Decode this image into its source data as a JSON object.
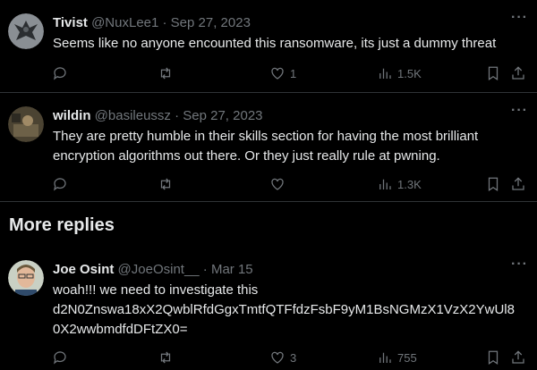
{
  "tweets": [
    {
      "name": "Tivist",
      "meta": "@NuxLee1 · Sep 27, 2023",
      "text": "Seems like no anyone encounted this ransomware, its just a dummy threat",
      "likes": "1",
      "views": "1.5K"
    },
    {
      "name": "wildin",
      "meta": "@basileussz · Sep 27, 2023",
      "text": "They are pretty humble in their skills section for having the most brilliant encryption algorithms out there. Or they just really rule at pwning.",
      "likes": "",
      "views": "1.3K"
    },
    {
      "name": "Joe Osint",
      "meta": "@JoeOsint__ · Mar 15",
      "text_line1": "woah!!! we need to investigate this",
      "text_line2": "d2N0Znswa18xX2QwblRfdGgxTmtfQTFfdzFsbF9yM1BsNGMzX1VzX2YwUl8",
      "text_line3": "0X2wwbmdfdDFtZX0=",
      "likes": "3",
      "views": "755"
    }
  ],
  "section_title": "More replies",
  "more_glyph": "···",
  "icons": [
    "reply-icon",
    "retweet-icon",
    "like-icon",
    "views-icon",
    "bookmark-icon",
    "share-icon"
  ]
}
